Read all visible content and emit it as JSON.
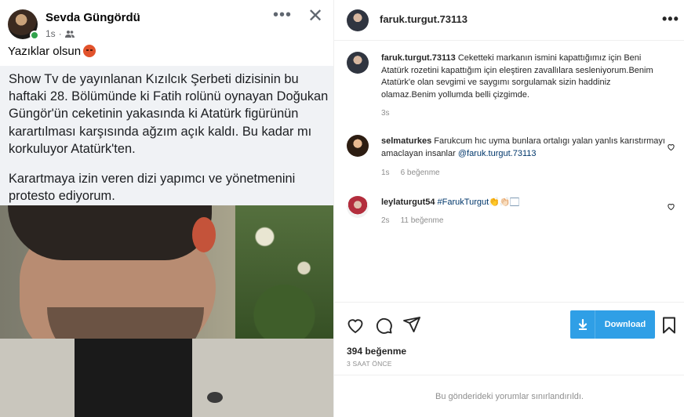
{
  "post_image": {
    "fb_author": "Sevda Güngördü",
    "fb_time": "1s",
    "fb_caption": "Yazıklar olsun",
    "fb_text_p1": "Show Tv de yayınlanan Kızılcık Şerbeti dizisinin bu haftaki 28. Bölümünde ki Fatih rolünü oynayan Doğukan Güngör'ün ceketinin yakasında ki Atatürk figürünün karartılması karşısında ağzım açık kaldı. Bu kadar mı korkuluyor Atatürk'ten.",
    "fb_text_p2": "Karartmaya izin veren dizi yapımcı ve yönetmenini protesto ediyorum."
  },
  "header": {
    "username": "faruk.turgut.73113"
  },
  "comments": [
    {
      "username": "faruk.turgut.73113",
      "text": "Ceketteki markanın ismini kapattığımız için Beni Atatürk rozetini kapattığım için eleştiren zavallılara sesleniyorum.Benim Atatürk'e olan sevgimi ve saygımı sorgulamak sizin haddiniz olamaz.Benim yollumda belli çizgimde.",
      "time": "3s"
    },
    {
      "username": "selmaturkes",
      "text": "Farukcum hıc uyma bunlara ortalıgı yalan yanlıs karıstırmayı amaclayan insanlar",
      "mention": "@faruk.turgut.73113",
      "time": "1s",
      "likes": "6 beğenme"
    },
    {
      "username": "leylaturgut54",
      "text": "#FarukTurgut👏👏🏻🏻",
      "time": "2s",
      "likes": "11 beğenme"
    }
  ],
  "actions": {
    "download_label": "Download"
  },
  "likes_count": "394 beğenme",
  "post_time": "3 SAAT ÖNCE",
  "comments_limited": "Bu gönderideki yorumlar sınırlandırıldı.",
  "colors": {
    "download_bg": "#2f9fe6",
    "mention": "#00376b",
    "muted": "#8e8e8e"
  }
}
